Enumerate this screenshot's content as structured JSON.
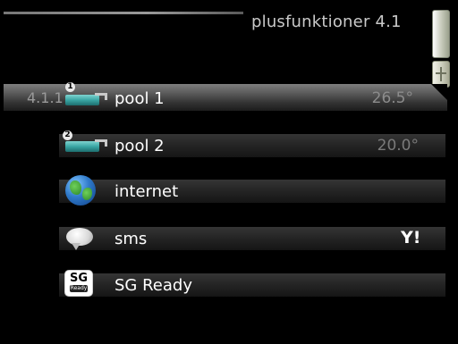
{
  "header": {
    "title": "plusfunktioner 4.1"
  },
  "menu": {
    "items": [
      {
        "number": "4.1.1",
        "badge": "1",
        "label": "pool 1",
        "value": "26.5°",
        "icon": "pool-icon"
      },
      {
        "badge": "2",
        "label": "pool 2",
        "value": "20.0°",
        "icon": "pool-icon"
      },
      {
        "label": "internet",
        "icon": "globe-icon"
      },
      {
        "label": "sms",
        "icon": "speech-bubble-icon",
        "status_icon": "antenna-icon"
      },
      {
        "label": "SG Ready",
        "icon": "sg-ready-icon",
        "icon_text": "SG",
        "icon_subtext": "Ready"
      }
    ]
  }
}
